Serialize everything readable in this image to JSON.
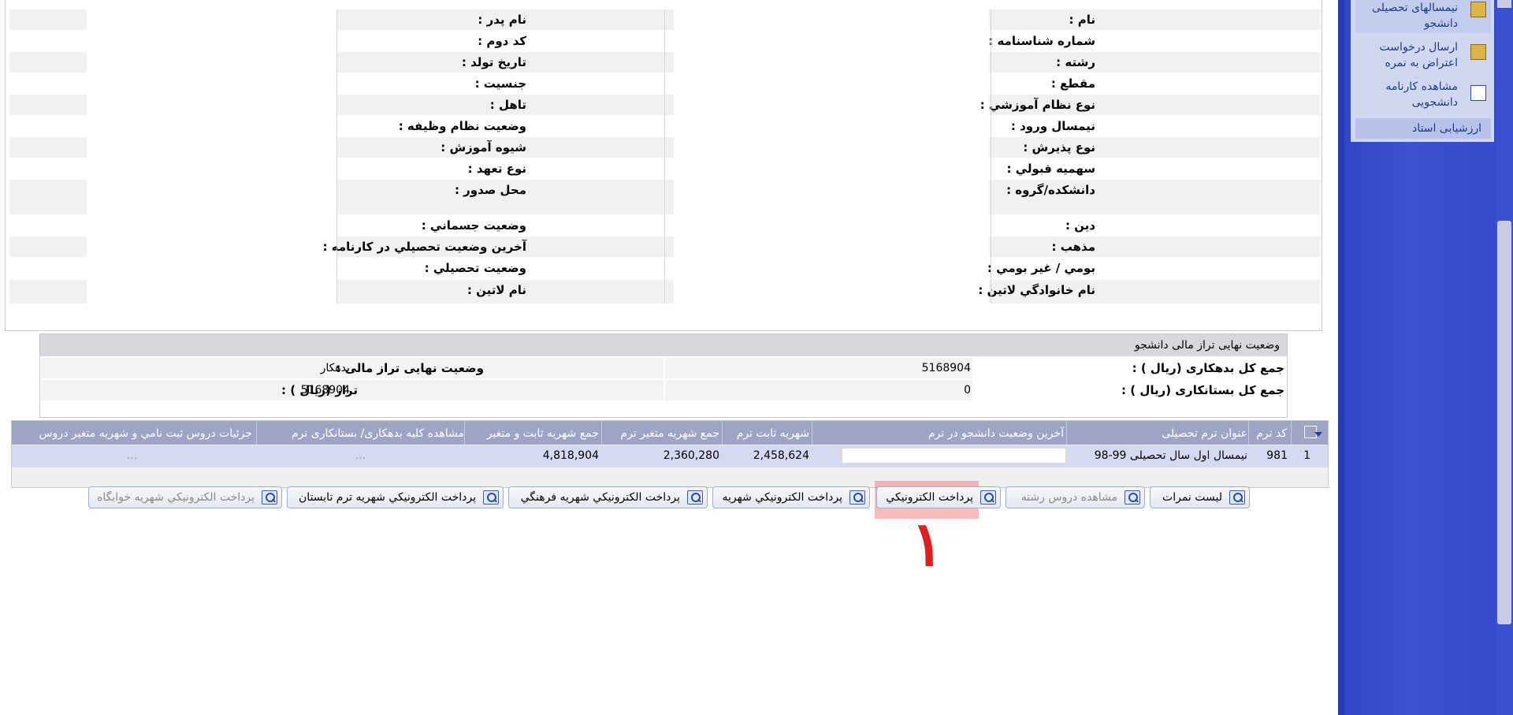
{
  "sidebar": {
    "items": [
      {
        "label": "نیمسالهای تحصیلی دانشجو"
      },
      {
        "label": "ارسال درخواست اعتراض به نمره"
      },
      {
        "label": "مشاهده کارنامه دانشجویی"
      }
    ],
    "selected_label": "ارزشیابی استاد"
  },
  "info": {
    "rows": [
      {
        "right_label": "نام :",
        "left_label": "نام پدر :"
      },
      {
        "right_label": "شماره شناسنامه :",
        "left_label": "کد دوم :"
      },
      {
        "right_label": "رشته :",
        "left_label": "تاريخ تولد :"
      },
      {
        "right_label": "مقطع :",
        "left_label": "جنسيت :"
      },
      {
        "right_label": "نوع نظام آموزشي :",
        "left_label": "تاهل :"
      },
      {
        "right_label": "نيمسال ورود :",
        "left_label": "وضعيت نظام وظيفه :"
      },
      {
        "right_label": "نوع پذيرش :",
        "left_label": "شيوه آموزش :"
      },
      {
        "right_label": "سهميه قبولي :",
        "left_label": "نوع تعهد :"
      },
      {
        "right_label": "دانشكده/گروه :",
        "left_label": "محل صدور :"
      },
      {
        "right_label": "دين :",
        "left_label": "وضعيت جسماني :"
      },
      {
        "right_label": "مذهب :",
        "left_label": "آخرين وضعيت تحصيلي در كارنامه :"
      },
      {
        "right_label": "بومي / غير بومي :",
        "left_label": "وضعيت تحصيلي :"
      },
      {
        "right_label": "نام خانوادگي لاتين :",
        "left_label": "نام لاتين :"
      }
    ]
  },
  "financial": {
    "title": "وضعیت نهایی تراز مالی دانشجو",
    "debt_label": "جمع کل بدهکاری (ریال ) :",
    "debt_value": "5168904",
    "credit_label": "جمع کل بستانکاری (ریال ) :",
    "credit_value": "0",
    "final_status_label": "وضعیت نهایی تراز مالی :",
    "final_status_value": "بدهکار",
    "balance_label": "تراز (ریال ) :",
    "balance_value": "5168904"
  },
  "grid": {
    "headers": {
      "term_code": "کد ترم",
      "term_title": "عنوان ترم تحصیلی",
      "last_status": "آخرین وضعیت دانشجو در ترم",
      "fixed_fee": "شهريه ثابت ترم",
      "var_fee": "جمع شهريه متغير ترم",
      "total_fee": "جمع شهريه ثابت و متغير",
      "view_debt": "مشاهده کلیه بدهکاری/ بستانکاری ترم",
      "course_details": "جزئیات دروس ثبت نامي و شهريه متغير دروس"
    },
    "row": {
      "index": "1",
      "term_code": "981",
      "term_title": "نیمسال اول سال تحصیلی 99-98",
      "fixed_fee": "2,458,624",
      "var_fee": "2,360,280",
      "total_fee": "4,818,904",
      "view_debt": "...",
      "course_details": "..."
    }
  },
  "buttons": {
    "grades_list": "ليست نمرات",
    "view_field_courses": "مشاهده دروس رشته",
    "e_payment": "پرداخت الكترونيكي",
    "e_payment_tuition": "پرداخت الكترونيكي شهريه",
    "e_payment_cultural": "پرداخت الكترونيكي شهريه فرهنگي",
    "e_payment_summer": "پرداخت الكترونيكي شهريه ترم تابستان",
    "e_payment_dorm": "پرداخت الكترونيكي شهريه خوابگاه"
  },
  "annotation": {
    "number": "١",
    "color": "#e21d1d"
  }
}
